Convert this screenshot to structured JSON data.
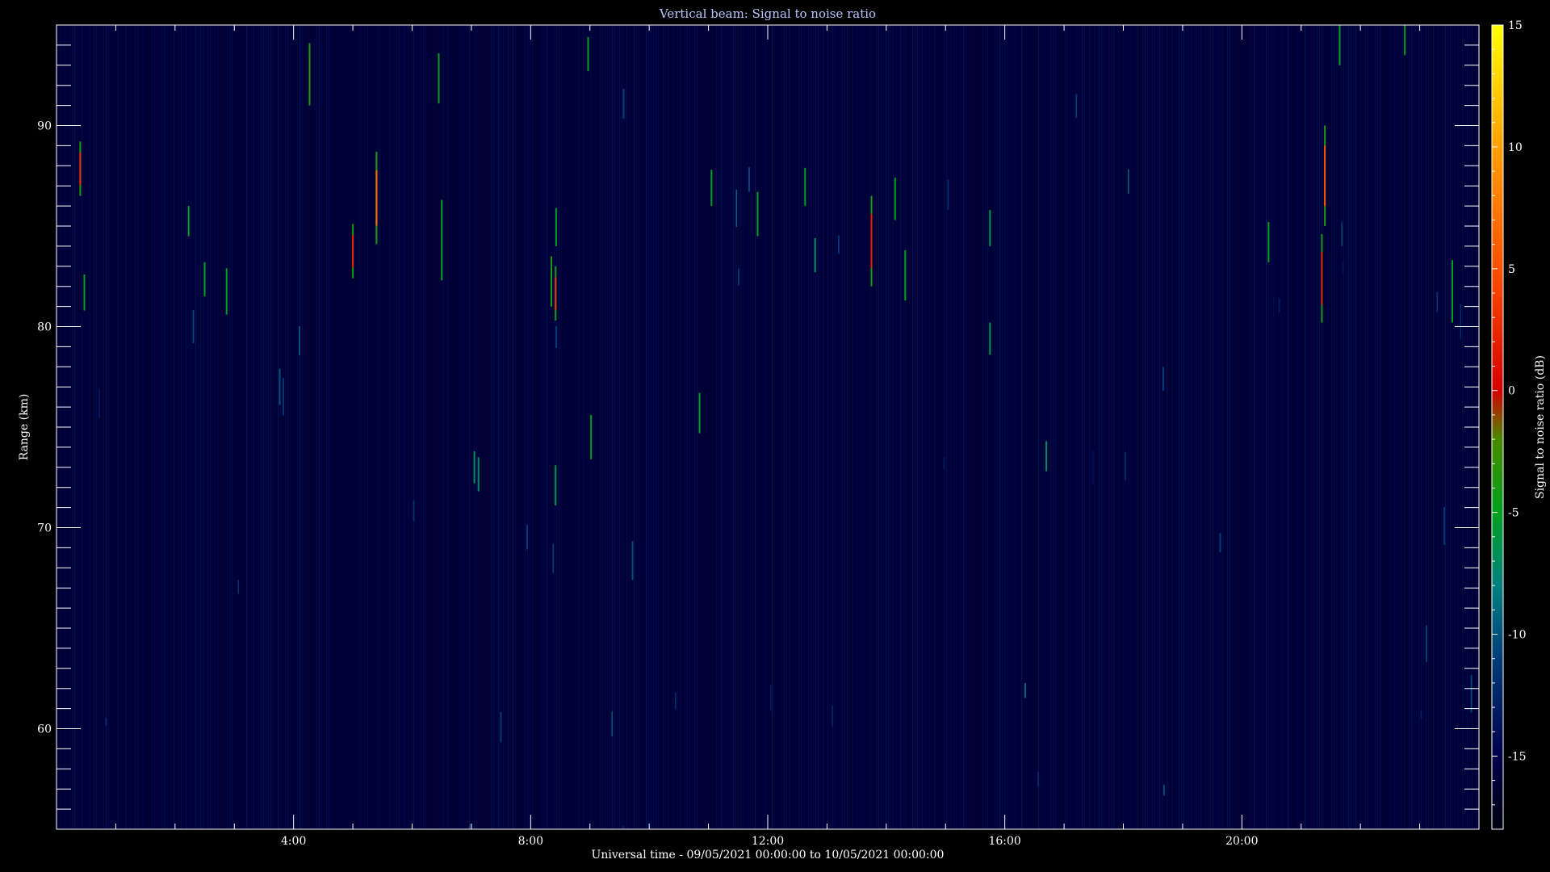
{
  "chart_data": {
    "type": "heatmap",
    "title": "Vertical beam: Signal to noise ratio",
    "xlabel": "Universal time - 09/05/2021 00:00:00 to 10/05/2021 00:00:00",
    "ylabel": "Range (km)",
    "colorbar_label": "Signal to noise ratio (dB)",
    "xlim_hours": [
      0,
      24
    ],
    "ylim_km": [
      55,
      95
    ],
    "color_range_db": [
      -18,
      15
    ],
    "x_ticks": [
      {
        "hours": 4,
        "label": "4:00"
      },
      {
        "hours": 8,
        "label": "8:00"
      },
      {
        "hours": 12,
        "label": "12:00"
      },
      {
        "hours": 16,
        "label": "16:00"
      },
      {
        "hours": 20,
        "label": "20:00"
      }
    ],
    "y_ticks": [
      {
        "km": 60,
        "label": "60"
      },
      {
        "km": 70,
        "label": "70"
      },
      {
        "km": 80,
        "label": "80"
      },
      {
        "km": 90,
        "label": "90"
      }
    ],
    "colorbar_ticks": [
      {
        "db": -15,
        "label": "-15"
      },
      {
        "db": -10,
        "label": "-10"
      },
      {
        "db": -5,
        "label": "-5"
      },
      {
        "db": 0,
        "label": "0"
      },
      {
        "db": 5,
        "label": "5"
      },
      {
        "db": 10,
        "label": "10"
      },
      {
        "db": 15,
        "label": "15"
      }
    ],
    "colormap": [
      {
        "db": -18,
        "color": "#000010"
      },
      {
        "db": -15,
        "color": "#00004a"
      },
      {
        "db": -11,
        "color": "#003c78"
      },
      {
        "db": -8,
        "color": "#008080"
      },
      {
        "db": -5,
        "color": "#00a020"
      },
      {
        "db": -2,
        "color": "#4a8a00"
      },
      {
        "db": 0,
        "color": "#d40000"
      },
      {
        "db": 5,
        "color": "#ff5000"
      },
      {
        "db": 10,
        "color": "#ffa000"
      },
      {
        "db": 15,
        "color": "#ffff00"
      }
    ],
    "background_level_db": -16,
    "strong_echoes": [
      {
        "t_hours": 0.4,
        "range_km": [
          86.5,
          89.2
        ],
        "peak_db": 3
      },
      {
        "t_hours": 0.47,
        "range_km": [
          80.8,
          82.6
        ],
        "peak_db": -5
      },
      {
        "t_hours": 2.23,
        "range_km": [
          84.5,
          86.0
        ],
        "peak_db": -5
      },
      {
        "t_hours": 2.5,
        "range_km": [
          81.5,
          83.2
        ],
        "peak_db": -5
      },
      {
        "t_hours": 2.87,
        "range_km": [
          80.6,
          82.9
        ],
        "peak_db": -5
      },
      {
        "t_hours": 4.27,
        "range_km": [
          91.0,
          94.1
        ],
        "peak_db": -3
      },
      {
        "t_hours": 5.0,
        "range_km": [
          82.4,
          85.1
        ],
        "peak_db": 2
      },
      {
        "t_hours": 5.4,
        "range_km": [
          84.1,
          88.7
        ],
        "peak_db": 7
      },
      {
        "t_hours": 6.45,
        "range_km": [
          91.1,
          93.6
        ],
        "peak_db": -5
      },
      {
        "t_hours": 6.5,
        "range_km": [
          82.3,
          86.3
        ],
        "peak_db": -5
      },
      {
        "t_hours": 7.05,
        "range_km": [
          72.2,
          73.8
        ],
        "peak_db": -7
      },
      {
        "t_hours": 7.12,
        "range_km": [
          71.8,
          73.5
        ],
        "peak_db": -7
      },
      {
        "t_hours": 8.35,
        "range_km": [
          81.0,
          83.5
        ],
        "peak_db": -4
      },
      {
        "t_hours": 8.42,
        "range_km": [
          80.3,
          83.0
        ],
        "peak_db": 3
      },
      {
        "t_hours": 8.43,
        "range_km": [
          84.0,
          85.9
        ],
        "peak_db": -5
      },
      {
        "t_hours": 8.42,
        "range_km": [
          71.1,
          73.1
        ],
        "peak_db": -6
      },
      {
        "t_hours": 8.97,
        "range_km": [
          92.7,
          94.4
        ],
        "peak_db": -5
      },
      {
        "t_hours": 9.02,
        "range_km": [
          73.4,
          75.6
        ],
        "peak_db": -5
      },
      {
        "t_hours": 10.85,
        "range_km": [
          74.7,
          76.7
        ],
        "peak_db": -5
      },
      {
        "t_hours": 11.05,
        "range_km": [
          86.0,
          87.8
        ],
        "peak_db": -5
      },
      {
        "t_hours": 11.83,
        "range_km": [
          84.5,
          86.7
        ],
        "peak_db": -5
      },
      {
        "t_hours": 12.63,
        "range_km": [
          86.0,
          87.9
        ],
        "peak_db": -5
      },
      {
        "t_hours": 12.8,
        "range_km": [
          82.7,
          84.4
        ],
        "peak_db": -7
      },
      {
        "t_hours": 13.75,
        "range_km": [
          82.0,
          86.5
        ],
        "peak_db": 2
      },
      {
        "t_hours": 14.15,
        "range_km": [
          85.3,
          87.4
        ],
        "peak_db": -5
      },
      {
        "t_hours": 14.32,
        "range_km": [
          81.3,
          83.8
        ],
        "peak_db": -5
      },
      {
        "t_hours": 15.75,
        "range_km": [
          84.0,
          85.8
        ],
        "peak_db": -6
      },
      {
        "t_hours": 15.75,
        "range_km": [
          78.6,
          80.2
        ],
        "peak_db": -6
      },
      {
        "t_hours": 16.7,
        "range_km": [
          72.8,
          74.3
        ],
        "peak_db": -7
      },
      {
        "t_hours": 20.45,
        "range_km": [
          83.2,
          85.2
        ],
        "peak_db": -5
      },
      {
        "t_hours": 21.35,
        "range_km": [
          80.2,
          84.6
        ],
        "peak_db": 2
      },
      {
        "t_hours": 21.4,
        "range_km": [
          85.0,
          90.0
        ],
        "peak_db": 5
      },
      {
        "t_hours": 21.65,
        "range_km": [
          93.0,
          95.0
        ],
        "peak_db": -5
      },
      {
        "t_hours": 22.75,
        "range_km": [
          93.5,
          95.0
        ],
        "peak_db": -5
      },
      {
        "t_hours": 23.55,
        "range_km": [
          80.2,
          83.3
        ],
        "peak_db": -5
      }
    ]
  }
}
